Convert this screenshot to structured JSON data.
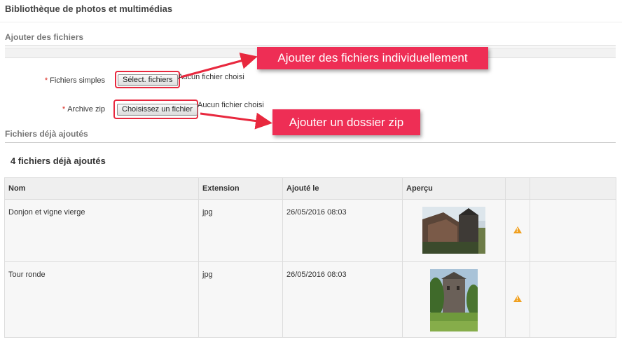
{
  "page": {
    "title": "Bibliothèque de photos et multimédias"
  },
  "add_section": {
    "heading": "Ajouter des fichiers",
    "simple": {
      "required_mark": "*",
      "label": "Fichiers simples",
      "button": "Sélect. fichiers",
      "status": "Aucun fichier choisi"
    },
    "zip": {
      "required_mark": "*",
      "label": "Archive zip",
      "button": "Choisissez un fichier",
      "status": "Aucun fichier choisi"
    }
  },
  "callouts": {
    "individual": "Ajouter des fichiers individuellement",
    "zip": "Ajouter un dossier zip"
  },
  "existing_section": {
    "heading": "Fichiers déjà ajoutés",
    "count_title": "4 fichiers déjà ajoutés",
    "columns": [
      "Nom",
      "Extension",
      "Ajouté le",
      "Aperçu",
      "",
      ""
    ],
    "rows": [
      {
        "name": "Donjon et vigne vierge",
        "extension": "jpg",
        "added": "26/05/2016 08:03",
        "status_icon": "warning-icon"
      },
      {
        "name": "Tour ronde",
        "extension": "jpg",
        "added": "26/05/2016 08:03",
        "status_icon": "warning-icon"
      }
    ]
  },
  "colors": {
    "callout_bg": "#ee2e55",
    "highlight": "#e8283e",
    "required": "#d9261c",
    "warning": "#f0a020"
  }
}
